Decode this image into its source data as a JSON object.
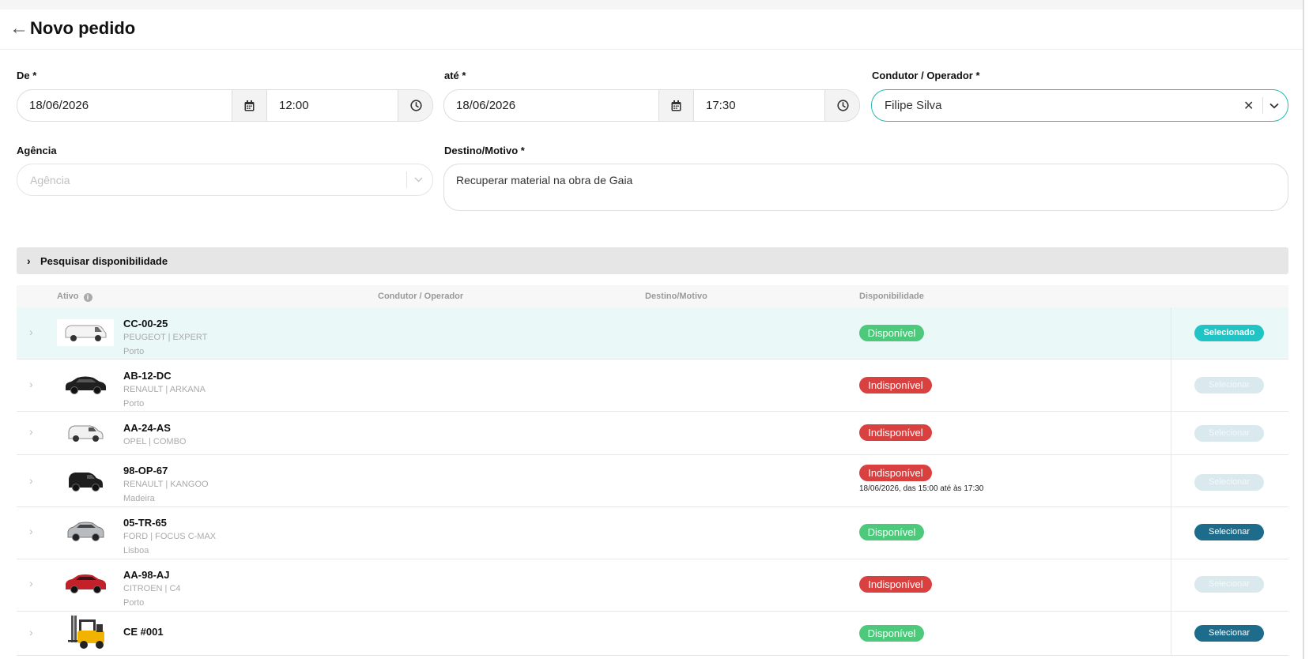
{
  "header": {
    "title": "Novo pedido",
    "back_icon": "arrow-left-icon"
  },
  "form": {
    "from": {
      "label": "De *",
      "date": "18/06/2026",
      "time": "12:00"
    },
    "to": {
      "label": "até *",
      "date": "18/06/2026",
      "time": "17:30"
    },
    "driver": {
      "label": "Condutor / Operador *",
      "value": "Filipe Silva"
    },
    "agency": {
      "label": "Agência",
      "placeholder": "Agência"
    },
    "destination": {
      "label": "Destino/Motivo *",
      "value": "Recuperar material na obra de Gaia"
    }
  },
  "search": {
    "label": "Pesquisar disponibilidade"
  },
  "table": {
    "headers": {
      "asset": "Ativo",
      "driver": "Condutor / Operador",
      "destination": "Destino/Motivo",
      "availability": "Disponibilidade"
    },
    "rows": [
      {
        "plate": "CC-00-25",
        "model": "PEUGEOT | EXPERT",
        "location": "Porto",
        "status": "Disponível",
        "action": "Selecionado"
      },
      {
        "plate": "AB-12-DC",
        "model": "RENAULT | ARKANA",
        "location": "Porto",
        "status": "Indisponível",
        "action": "Selecionar"
      },
      {
        "plate": "AA-24-AS",
        "model": "OPEL | COMBO",
        "location": "",
        "status": "Indisponível",
        "action": "Selecionar"
      },
      {
        "plate": "98-OP-67",
        "model": "RENAULT | KANGOO",
        "location": "Madeira",
        "status": "Indisponível",
        "note": "18/06/2026, das 15:00 até às 17:30",
        "action": "Selecionar"
      },
      {
        "plate": "05-TR-65",
        "model": "FORD | FOCUS C-MAX",
        "location": "Lisboa",
        "status": "Disponível",
        "action": "Selecionar"
      },
      {
        "plate": "AA-98-AJ",
        "model": "CITROEN | C4",
        "location": "Porto",
        "status": "Indisponível",
        "action": "Selecionar"
      },
      {
        "plate": "CE #001",
        "model": "",
        "location": "",
        "status": "Disponível",
        "action": "Selecionar"
      }
    ]
  },
  "colors": {
    "teal": "#21c4c4",
    "green": "#4cc97a",
    "red": "#d94040",
    "dark_blue": "#1d6c8c"
  }
}
